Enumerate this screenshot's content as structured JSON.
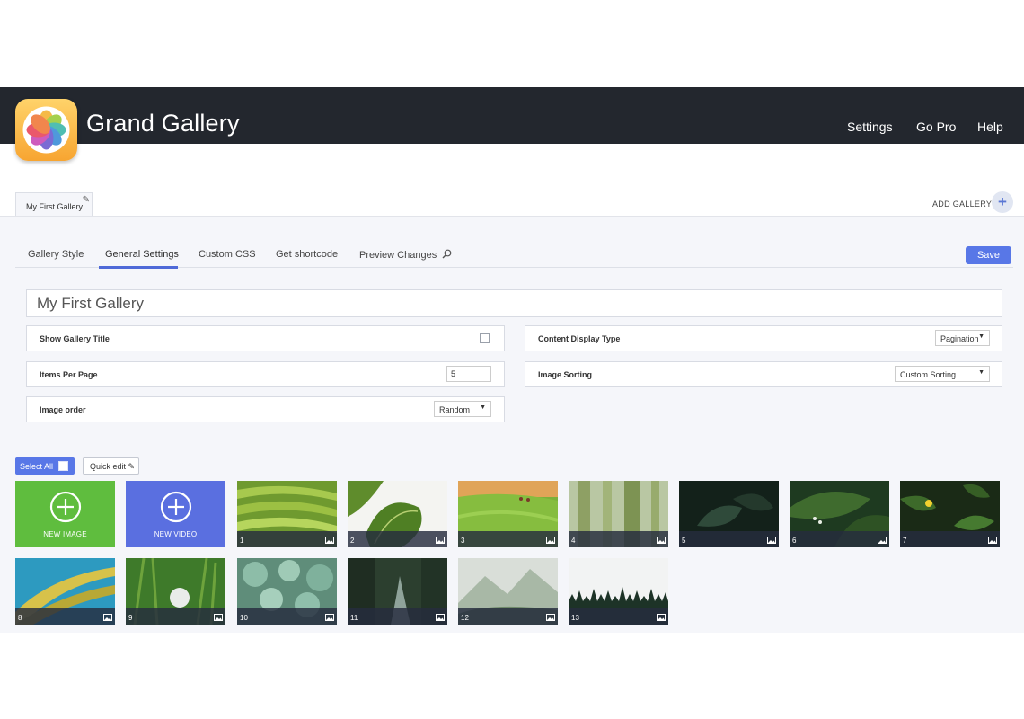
{
  "header": {
    "title": "Grand Gallery",
    "nav": [
      "Settings",
      "Go Pro",
      "Help"
    ]
  },
  "gallery_tabs": {
    "current": "My First Gallery",
    "add_label": "ADD GALLERY",
    "add_icon": "plus-icon"
  },
  "subtabs": [
    "Gallery Style",
    "General Settings",
    "Custom CSS",
    "Get shortcode",
    "Preview Changes"
  ],
  "active_subtab": "General Settings",
  "save_label": "Save",
  "gallery_name": "My First Gallery",
  "settings": {
    "show_title": {
      "label": "Show Gallery Title",
      "checked": false
    },
    "items_per_page": {
      "label": "Items Per Page",
      "value": "5"
    },
    "image_order": {
      "label": "Image order",
      "value": "Random"
    },
    "content_display": {
      "label": "Content Display Type",
      "value": "Pagination"
    },
    "image_sorting": {
      "label": "Image Sorting",
      "value": "Custom Sorting"
    }
  },
  "toolbar": {
    "select_all": "Select All",
    "quick_edit": "Quick edit"
  },
  "add_tiles": {
    "new_image": "NEW IMAGE",
    "new_video": "NEW VIDEO"
  },
  "images": [
    "1",
    "2",
    "3",
    "4",
    "5",
    "6",
    "7",
    "8",
    "9",
    "10",
    "11",
    "12",
    "13"
  ],
  "colors": {
    "topbar": "#23272e",
    "accent": "#5877e7",
    "new_image_bg": "#5fbd3e",
    "new_video_bg": "#5a6fe0"
  }
}
